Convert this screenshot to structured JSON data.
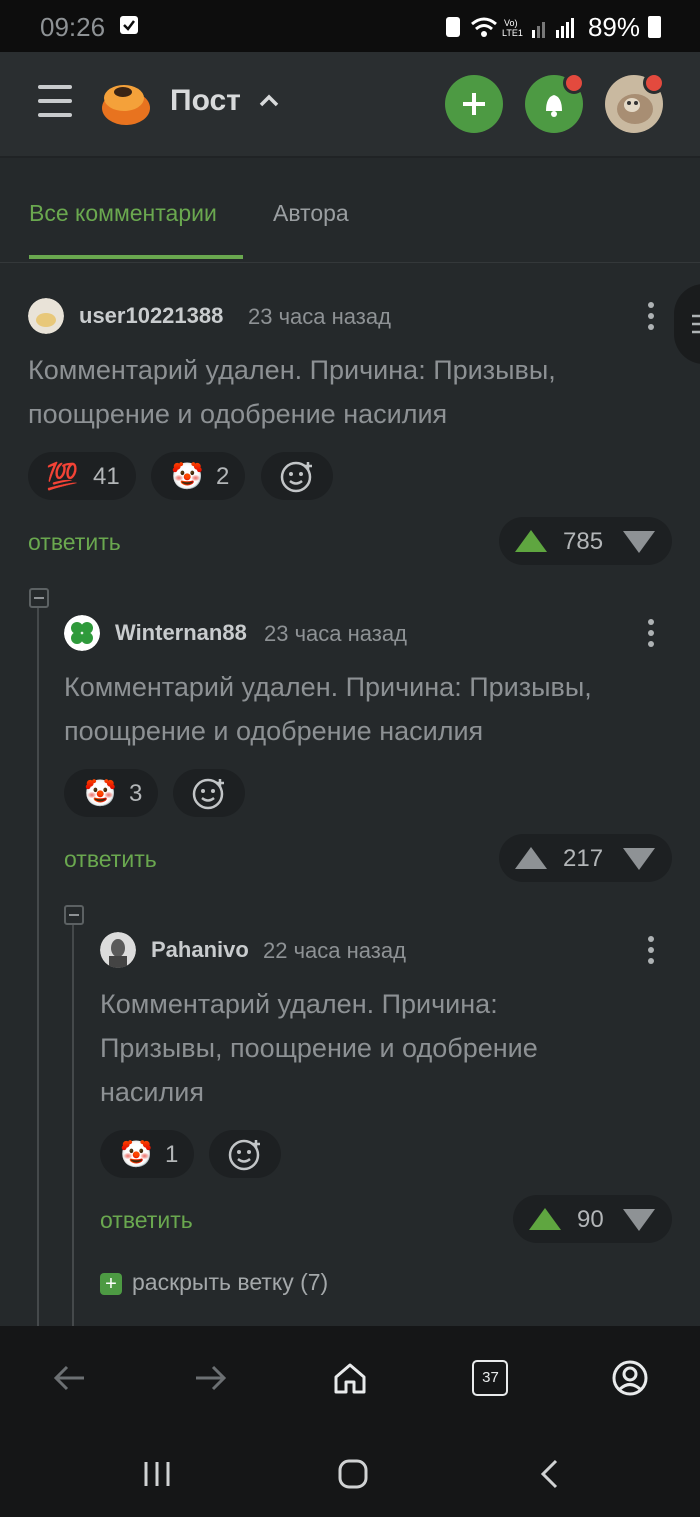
{
  "status_bar": {
    "time": "09:26",
    "battery": "89%"
  },
  "header": {
    "title": "Пост"
  },
  "tabs": [
    {
      "label": "Все комментарии"
    },
    {
      "label": "Автора"
    }
  ],
  "comments": [
    {
      "username": "user10221388",
      "time": "23 часа назад",
      "text": "Комментарий удален. Причина: Призывы, поощрение и одобрение насилия",
      "reactions": [
        {
          "emoji": "💯",
          "count": "41"
        },
        {
          "emoji": "🤡",
          "count": "2"
        }
      ],
      "reply_label": "ответить",
      "votes": "785"
    },
    {
      "username": "Winternan88",
      "time": "23 часа назад",
      "text": "Комментарий удален. Причина: Призывы, поощрение и одобрение насилия",
      "reactions": [
        {
          "emoji": "🤡",
          "count": "3"
        }
      ],
      "reply_label": "ответить",
      "votes": "217"
    },
    {
      "username": "Pahanivo",
      "time": "22 часа назад",
      "text": "Комментарий удален. Причина: Призывы, поощрение и одобрение насилия",
      "reactions": [
        {
          "emoji": "🤡",
          "count": "1"
        }
      ],
      "reply_label": "ответить",
      "votes": "90"
    }
  ],
  "expand_branch": {
    "label": "раскрыть ветку (7)"
  },
  "browser_nav": {
    "tab_count": "37"
  },
  "colors": {
    "accent": "#6aa84f",
    "badge": "#e34a3e",
    "background": "#25292b"
  }
}
